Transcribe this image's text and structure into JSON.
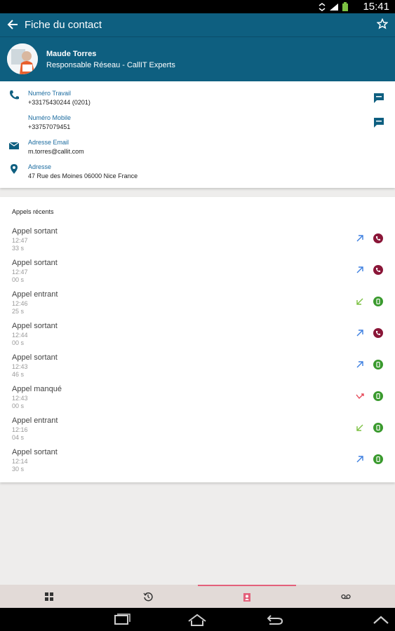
{
  "status_bar": {
    "time": "15:41",
    "icons": [
      "sync-icon",
      "signal-icon",
      "battery-icon"
    ]
  },
  "app_bar": {
    "title": "Fiche du contact",
    "back_icon": "arrow-left-icon",
    "star_icon": "star-outline-icon"
  },
  "contact": {
    "name": "Maude Torres",
    "role": "Responsable Réseau - CallIT Experts"
  },
  "info": {
    "work_label": "Numéro Travail",
    "work_value": "+33175430244 (0201)",
    "mobile_label": "Numéro Mobile",
    "mobile_value": "+33757079451",
    "email_label": "Adresse Email",
    "email_value": "m.torres@callit.com",
    "address_label": "Adresse",
    "address_value": "47 Rue des Moines 06000 Nice France"
  },
  "recent_calls": {
    "title": "Appels récents",
    "items": [
      {
        "type": "Appel sortant",
        "time": "12:47",
        "duration": "33 s",
        "direction": "outgoing",
        "status": "hangup"
      },
      {
        "type": "Appel sortant",
        "time": "12:47",
        "duration": "00 s",
        "direction": "outgoing",
        "status": "hangup"
      },
      {
        "type": "Appel entrant",
        "time": "12:46",
        "duration": "25 s",
        "direction": "incoming",
        "status": "answered"
      },
      {
        "type": "Appel sortant",
        "time": "12:44",
        "duration": "00 s",
        "direction": "outgoing",
        "status": "hangup"
      },
      {
        "type": "Appel sortant",
        "time": "12:43",
        "duration": "46 s",
        "direction": "outgoing",
        "status": "answered"
      },
      {
        "type": "Appel manqué",
        "time": "12:43",
        "duration": "00 s",
        "direction": "missed",
        "status": "answered"
      },
      {
        "type": "Appel entrant",
        "time": "12:16",
        "duration": "04 s",
        "direction": "incoming",
        "status": "answered"
      },
      {
        "type": "Appel sortant",
        "time": "12:14",
        "duration": "30 s",
        "direction": "outgoing",
        "status": "answered"
      }
    ]
  },
  "tabs": [
    {
      "icon": "grid-icon",
      "active": false
    },
    {
      "icon": "history-icon",
      "active": false
    },
    {
      "icon": "contact-card-icon",
      "active": true
    },
    {
      "icon": "voicemail-icon",
      "active": false
    }
  ],
  "colors": {
    "primary": "#0e5f80",
    "outgoing_arrow": "#3d7fe0",
    "incoming_arrow": "#7cc142",
    "missed_arrow": "#e64a5a",
    "hangup": "#8a1638",
    "answered": "#3a9a2e",
    "tab_accent": "#e3607a"
  }
}
